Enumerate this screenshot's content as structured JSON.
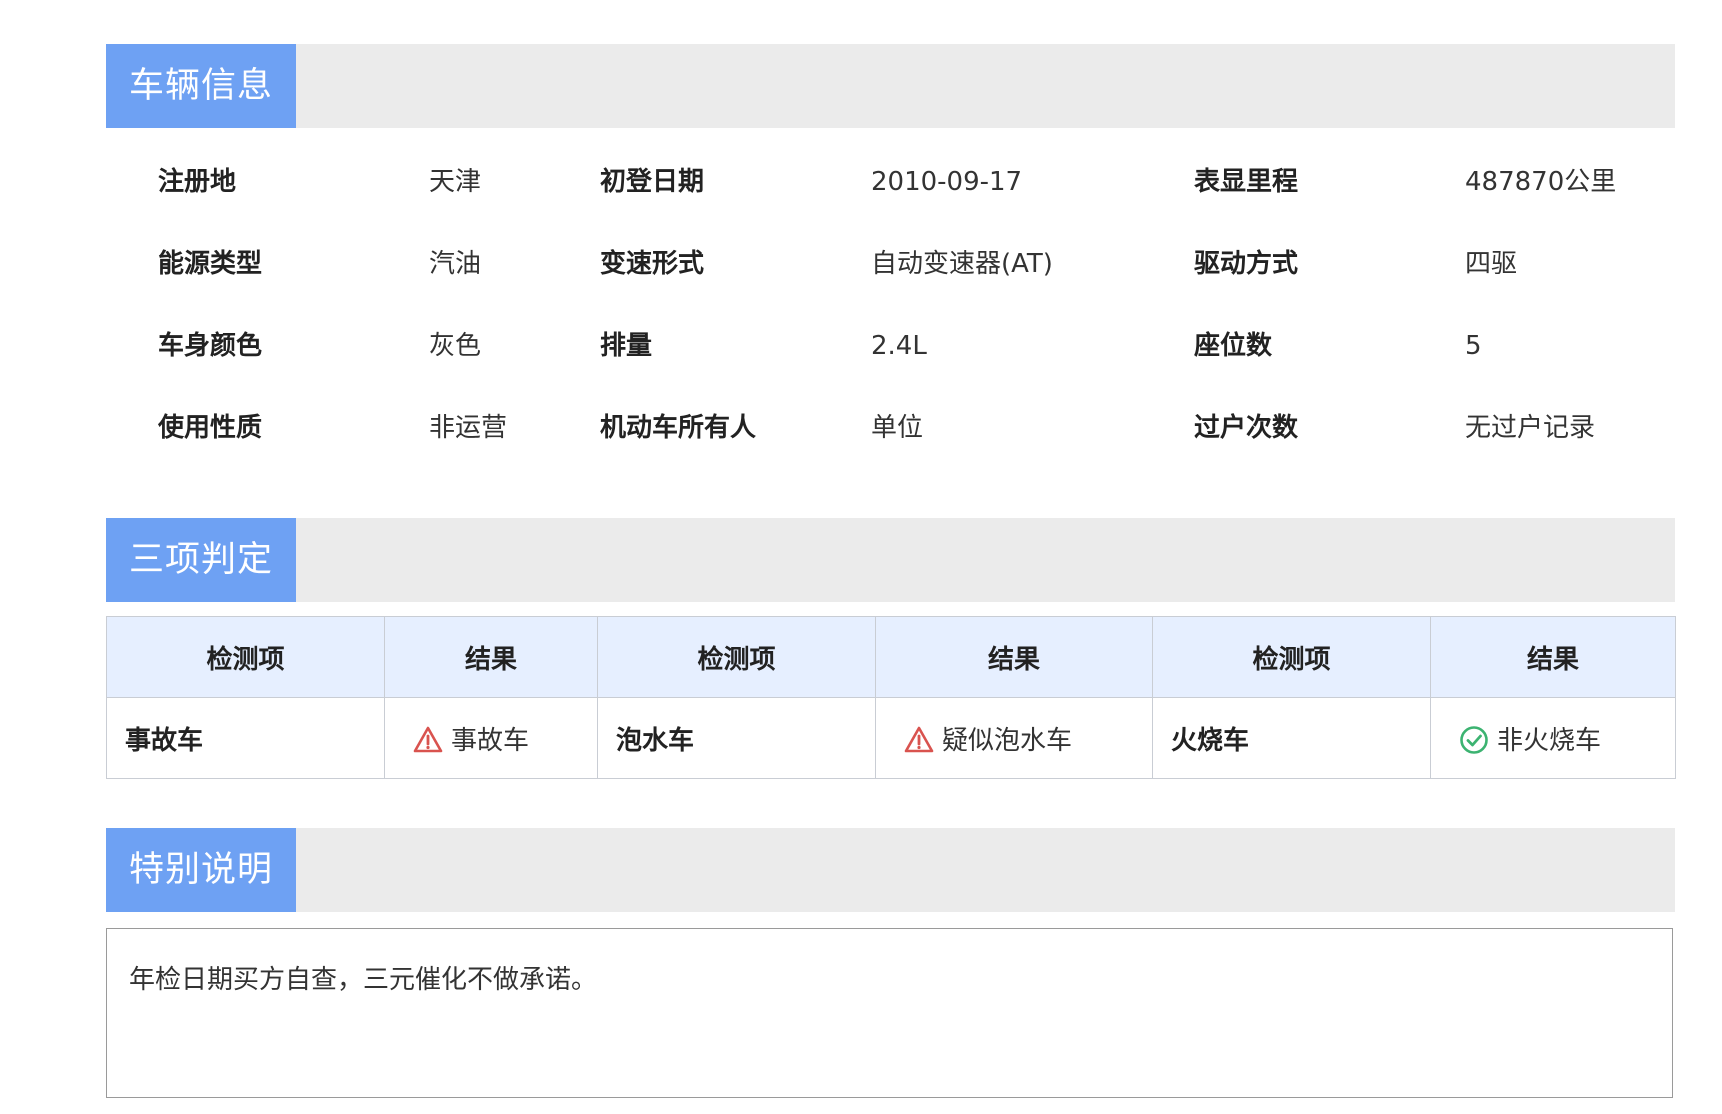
{
  "sections": {
    "vehicle": {
      "title": "车辆信息"
    },
    "judge": {
      "title": "三项判定"
    },
    "special": {
      "title": "特别说明"
    }
  },
  "vehicle_info": {
    "rows": [
      [
        {
          "label": "注册地",
          "value": "天津"
        },
        {
          "label": "初登日期",
          "value": "2010-09-17"
        },
        {
          "label": "表显里程",
          "value": "487870公里"
        }
      ],
      [
        {
          "label": "能源类型",
          "value": "汽油"
        },
        {
          "label": "变速形式",
          "value": "自动变速器(AT)"
        },
        {
          "label": "驱动方式",
          "value": "四驱"
        }
      ],
      [
        {
          "label": "车身颜色",
          "value": "灰色"
        },
        {
          "label": "排量",
          "value": "2.4L"
        },
        {
          "label": "座位数",
          "value": "5"
        }
      ],
      [
        {
          "label": "使用性质",
          "value": "非运营"
        },
        {
          "label": "机动车所有人",
          "value": "单位"
        },
        {
          "label": "过户次数",
          "value": "无过户记录"
        }
      ]
    ]
  },
  "judge_table": {
    "headers": [
      "检测项",
      "结果",
      "检测项",
      "结果",
      "检测项",
      "结果"
    ],
    "items": [
      {
        "item": "事故车",
        "result": "事故车",
        "icon": "warning-icon",
        "color": "#d9534f"
      },
      {
        "item": "泡水车",
        "result": "疑似泡水车",
        "icon": "warning-icon",
        "color": "#d9534f"
      },
      {
        "item": "火烧车",
        "result": "非火烧车",
        "icon": "check-circle-icon",
        "color": "#3cb371"
      }
    ]
  },
  "special_note": {
    "text": "年检日期买方自查，三元催化不做承诺。"
  },
  "colors": {
    "tab": "#6ea1f3",
    "bar": "#ebebeb",
    "header_bg": "#e6efff",
    "warning": "#d9534f",
    "ok": "#3cb371"
  }
}
